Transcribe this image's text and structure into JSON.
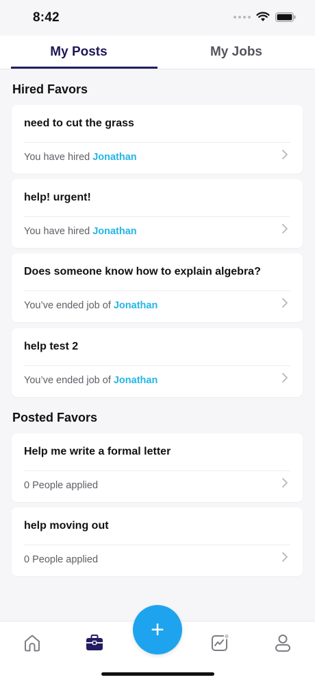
{
  "status": {
    "time": "8:42"
  },
  "tabs": {
    "my_posts": "My Posts",
    "my_jobs": "My Jobs"
  },
  "hired": {
    "title": "Hired Favors",
    "items": [
      {
        "title": "need to cut the grass",
        "status": "You have hired",
        "name": "Jonathan"
      },
      {
        "title": "help! urgent!",
        "status": "You have hired",
        "name": "Jonathan"
      },
      {
        "title": "Does someone know how to explain algebra?",
        "status": "You’ve ended job of",
        "name": "Jonathan"
      },
      {
        "title": "help test 2",
        "status": "You’ve ended job of",
        "name": "Jonathan"
      }
    ]
  },
  "posted": {
    "title": "Posted Favors",
    "items": [
      {
        "title": "Help me write a formal letter",
        "status": "0 People applied"
      },
      {
        "title": "help moving out",
        "status": "0 People applied"
      }
    ]
  },
  "fab": {
    "label": "+"
  },
  "icons": [
    "wifi-icon",
    "battery-icon",
    "chevron-right-icon",
    "home-icon",
    "briefcase-icon",
    "activity-icon",
    "profile-icon"
  ],
  "colors": {
    "accent": "#1ea4ee",
    "name_link": "#24b6e6",
    "tab_active": "#1e1856"
  }
}
